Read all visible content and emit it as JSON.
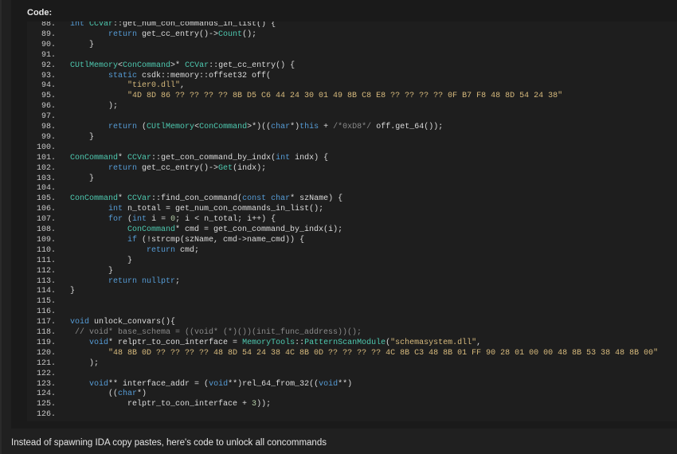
{
  "code_block": {
    "header": "Code:",
    "lines": [
      {
        "num": "88.",
        "tokens": [
          {
            "c": "k",
            "t": "int "
          },
          {
            "c": "t",
            "t": "CCVar"
          },
          {
            "c": "d",
            "t": "::get_num_con_commands_in_list() {"
          }
        ]
      },
      {
        "num": "89.",
        "tokens": [
          {
            "c": "d",
            "t": "        "
          },
          {
            "c": "k",
            "t": "return "
          },
          {
            "c": "d",
            "t": "get_cc_entry()->"
          },
          {
            "c": "t",
            "t": "Count"
          },
          {
            "c": "d",
            "t": "();"
          }
        ]
      },
      {
        "num": "90.",
        "tokens": [
          {
            "c": "d",
            "t": "    }"
          }
        ]
      },
      {
        "num": "91.",
        "tokens": []
      },
      {
        "num": "92.",
        "tokens": [
          {
            "c": "t",
            "t": "CUtlMemory"
          },
          {
            "c": "d",
            "t": "<"
          },
          {
            "c": "t",
            "t": "ConCommand"
          },
          {
            "c": "d",
            "t": ">* "
          },
          {
            "c": "t",
            "t": "CCVar"
          },
          {
            "c": "d",
            "t": "::get_cc_entry() {"
          }
        ]
      },
      {
        "num": "93.",
        "tokens": [
          {
            "c": "d",
            "t": "        "
          },
          {
            "c": "k",
            "t": "static "
          },
          {
            "c": "d",
            "t": "csdk::memory::offset32 off("
          }
        ]
      },
      {
        "num": "94.",
        "tokens": [
          {
            "c": "d",
            "t": "            "
          },
          {
            "c": "s",
            "t": "\"tier0.dll\""
          },
          {
            "c": "d",
            "t": ","
          }
        ]
      },
      {
        "num": "95.",
        "tokens": [
          {
            "c": "d",
            "t": "            "
          },
          {
            "c": "s",
            "t": "\"4D 8D 86 ?? ?? ?? ?? 8B D5 C6 44 24 30 01 49 8B C8 E8 ?? ?? ?? ?? 0F B7 F8 48 8D 54 24 38\""
          }
        ]
      },
      {
        "num": "96.",
        "tokens": [
          {
            "c": "d",
            "t": "        );"
          }
        ]
      },
      {
        "num": "97.",
        "tokens": []
      },
      {
        "num": "98.",
        "tokens": [
          {
            "c": "d",
            "t": "        "
          },
          {
            "c": "k",
            "t": "return "
          },
          {
            "c": "d",
            "t": "("
          },
          {
            "c": "t",
            "t": "CUtlMemory"
          },
          {
            "c": "d",
            "t": "<"
          },
          {
            "c": "t",
            "t": "ConCommand"
          },
          {
            "c": "d",
            "t": ">*)(("
          },
          {
            "c": "k",
            "t": "char"
          },
          {
            "c": "d",
            "t": "*)"
          },
          {
            "c": "k",
            "t": "this "
          },
          {
            "c": "d",
            "t": "+ "
          },
          {
            "c": "c",
            "t": "/*0xD8*/ "
          },
          {
            "c": "d",
            "t": "off.get_64());"
          }
        ]
      },
      {
        "num": "99.",
        "tokens": [
          {
            "c": "d",
            "t": "    }"
          }
        ]
      },
      {
        "num": "100.",
        "tokens": []
      },
      {
        "num": "101.",
        "tokens": [
          {
            "c": "t",
            "t": "ConCommand"
          },
          {
            "c": "d",
            "t": "* "
          },
          {
            "c": "t",
            "t": "CCVar"
          },
          {
            "c": "d",
            "t": "::get_con_command_by_indx("
          },
          {
            "c": "k",
            "t": "int "
          },
          {
            "c": "d",
            "t": "indx) {"
          }
        ]
      },
      {
        "num": "102.",
        "tokens": [
          {
            "c": "d",
            "t": "        "
          },
          {
            "c": "k",
            "t": "return "
          },
          {
            "c": "d",
            "t": "get_cc_entry()->"
          },
          {
            "c": "t",
            "t": "Get"
          },
          {
            "c": "d",
            "t": "(indx);"
          }
        ]
      },
      {
        "num": "103.",
        "tokens": [
          {
            "c": "d",
            "t": "    }"
          }
        ]
      },
      {
        "num": "104.",
        "tokens": []
      },
      {
        "num": "105.",
        "tokens": [
          {
            "c": "t",
            "t": "ConCommand"
          },
          {
            "c": "d",
            "t": "* "
          },
          {
            "c": "t",
            "t": "CCVar"
          },
          {
            "c": "d",
            "t": "::find_con_command("
          },
          {
            "c": "k",
            "t": "const char"
          },
          {
            "c": "d",
            "t": "* szName) {"
          }
        ]
      },
      {
        "num": "106.",
        "tokens": [
          {
            "c": "d",
            "t": "        "
          },
          {
            "c": "k",
            "t": "int "
          },
          {
            "c": "d",
            "t": "n_total = get_num_con_commands_in_list();"
          }
        ]
      },
      {
        "num": "107.",
        "tokens": [
          {
            "c": "d",
            "t": "        "
          },
          {
            "c": "k",
            "t": "for "
          },
          {
            "c": "d",
            "t": "("
          },
          {
            "c": "k",
            "t": "int "
          },
          {
            "c": "d",
            "t": "i = "
          },
          {
            "c": "n",
            "t": "0"
          },
          {
            "c": "d",
            "t": "; i < n_total; i++) {"
          }
        ]
      },
      {
        "num": "108.",
        "tokens": [
          {
            "c": "d",
            "t": "            "
          },
          {
            "c": "t",
            "t": "ConCommand"
          },
          {
            "c": "d",
            "t": "* cmd = get_con_command_by_indx(i);"
          }
        ]
      },
      {
        "num": "109.",
        "tokens": [
          {
            "c": "d",
            "t": "            "
          },
          {
            "c": "k",
            "t": "if "
          },
          {
            "c": "d",
            "t": "(!strcmp(szName, cmd->name_cmd)) {"
          }
        ]
      },
      {
        "num": "110.",
        "tokens": [
          {
            "c": "d",
            "t": "                "
          },
          {
            "c": "k",
            "t": "return "
          },
          {
            "c": "d",
            "t": "cmd;"
          }
        ]
      },
      {
        "num": "111.",
        "tokens": [
          {
            "c": "d",
            "t": "            }"
          }
        ]
      },
      {
        "num": "112.",
        "tokens": [
          {
            "c": "d",
            "t": "        }"
          }
        ]
      },
      {
        "num": "113.",
        "tokens": [
          {
            "c": "d",
            "t": "        "
          },
          {
            "c": "k",
            "t": "return "
          },
          {
            "c": "k",
            "t": "nullptr"
          },
          {
            "c": "d",
            "t": ";"
          }
        ]
      },
      {
        "num": "114.",
        "tokens": [
          {
            "c": "d",
            "t": "}"
          }
        ]
      },
      {
        "num": "115.",
        "tokens": []
      },
      {
        "num": "116.",
        "tokens": []
      },
      {
        "num": "117.",
        "tokens": [
          {
            "c": "k",
            "t": "void "
          },
          {
            "c": "d",
            "t": "unlock_convars(){"
          }
        ]
      },
      {
        "num": "118.",
        "tokens": [
          {
            "c": "c",
            "t": " // void* base_schema = ((void* (*)())(init_func_address))();"
          }
        ]
      },
      {
        "num": "119.",
        "tokens": [
          {
            "c": "d",
            "t": "    "
          },
          {
            "c": "k",
            "t": "void"
          },
          {
            "c": "d",
            "t": "* relptr_to_con_interface = "
          },
          {
            "c": "t",
            "t": "MemoryTools"
          },
          {
            "c": "d",
            "t": "::"
          },
          {
            "c": "t",
            "t": "PatternScanModule"
          },
          {
            "c": "d",
            "t": "("
          },
          {
            "c": "s",
            "t": "\"schemasystem.dll\""
          },
          {
            "c": "d",
            "t": ","
          }
        ]
      },
      {
        "num": "120.",
        "tokens": [
          {
            "c": "d",
            "t": "        "
          },
          {
            "c": "s",
            "t": "\"48 8B 0D ?? ?? ?? ?? 48 8D 54 24 38 4C 8B 0D ?? ?? ?? ?? 4C 8B C3 48 8B 01 FF 90 28 01 00 00 48 8B 53 38 48 8B 00\""
          }
        ]
      },
      {
        "num": "121.",
        "tokens": [
          {
            "c": "d",
            "t": "    );"
          }
        ]
      },
      {
        "num": "122.",
        "tokens": []
      },
      {
        "num": "123.",
        "tokens": [
          {
            "c": "d",
            "t": "    "
          },
          {
            "c": "k",
            "t": "void"
          },
          {
            "c": "d",
            "t": "** interface_addr = ("
          },
          {
            "c": "k",
            "t": "void"
          },
          {
            "c": "d",
            "t": "**)rel_64_from_32(("
          },
          {
            "c": "k",
            "t": "void"
          },
          {
            "c": "d",
            "t": "**)"
          }
        ]
      },
      {
        "num": "124.",
        "tokens": [
          {
            "c": "d",
            "t": "        (("
          },
          {
            "c": "k",
            "t": "char"
          },
          {
            "c": "d",
            "t": "*)"
          }
        ]
      },
      {
        "num": "125.",
        "tokens": [
          {
            "c": "d",
            "t": "            relptr_to_con_interface + "
          },
          {
            "c": "n",
            "t": "3"
          },
          {
            "c": "d",
            "t": "));"
          }
        ]
      },
      {
        "num": "126.",
        "tokens": []
      }
    ]
  },
  "post": {
    "text": "Instead of spawning IDA copy pastes, here's code to unlock all concommands"
  }
}
